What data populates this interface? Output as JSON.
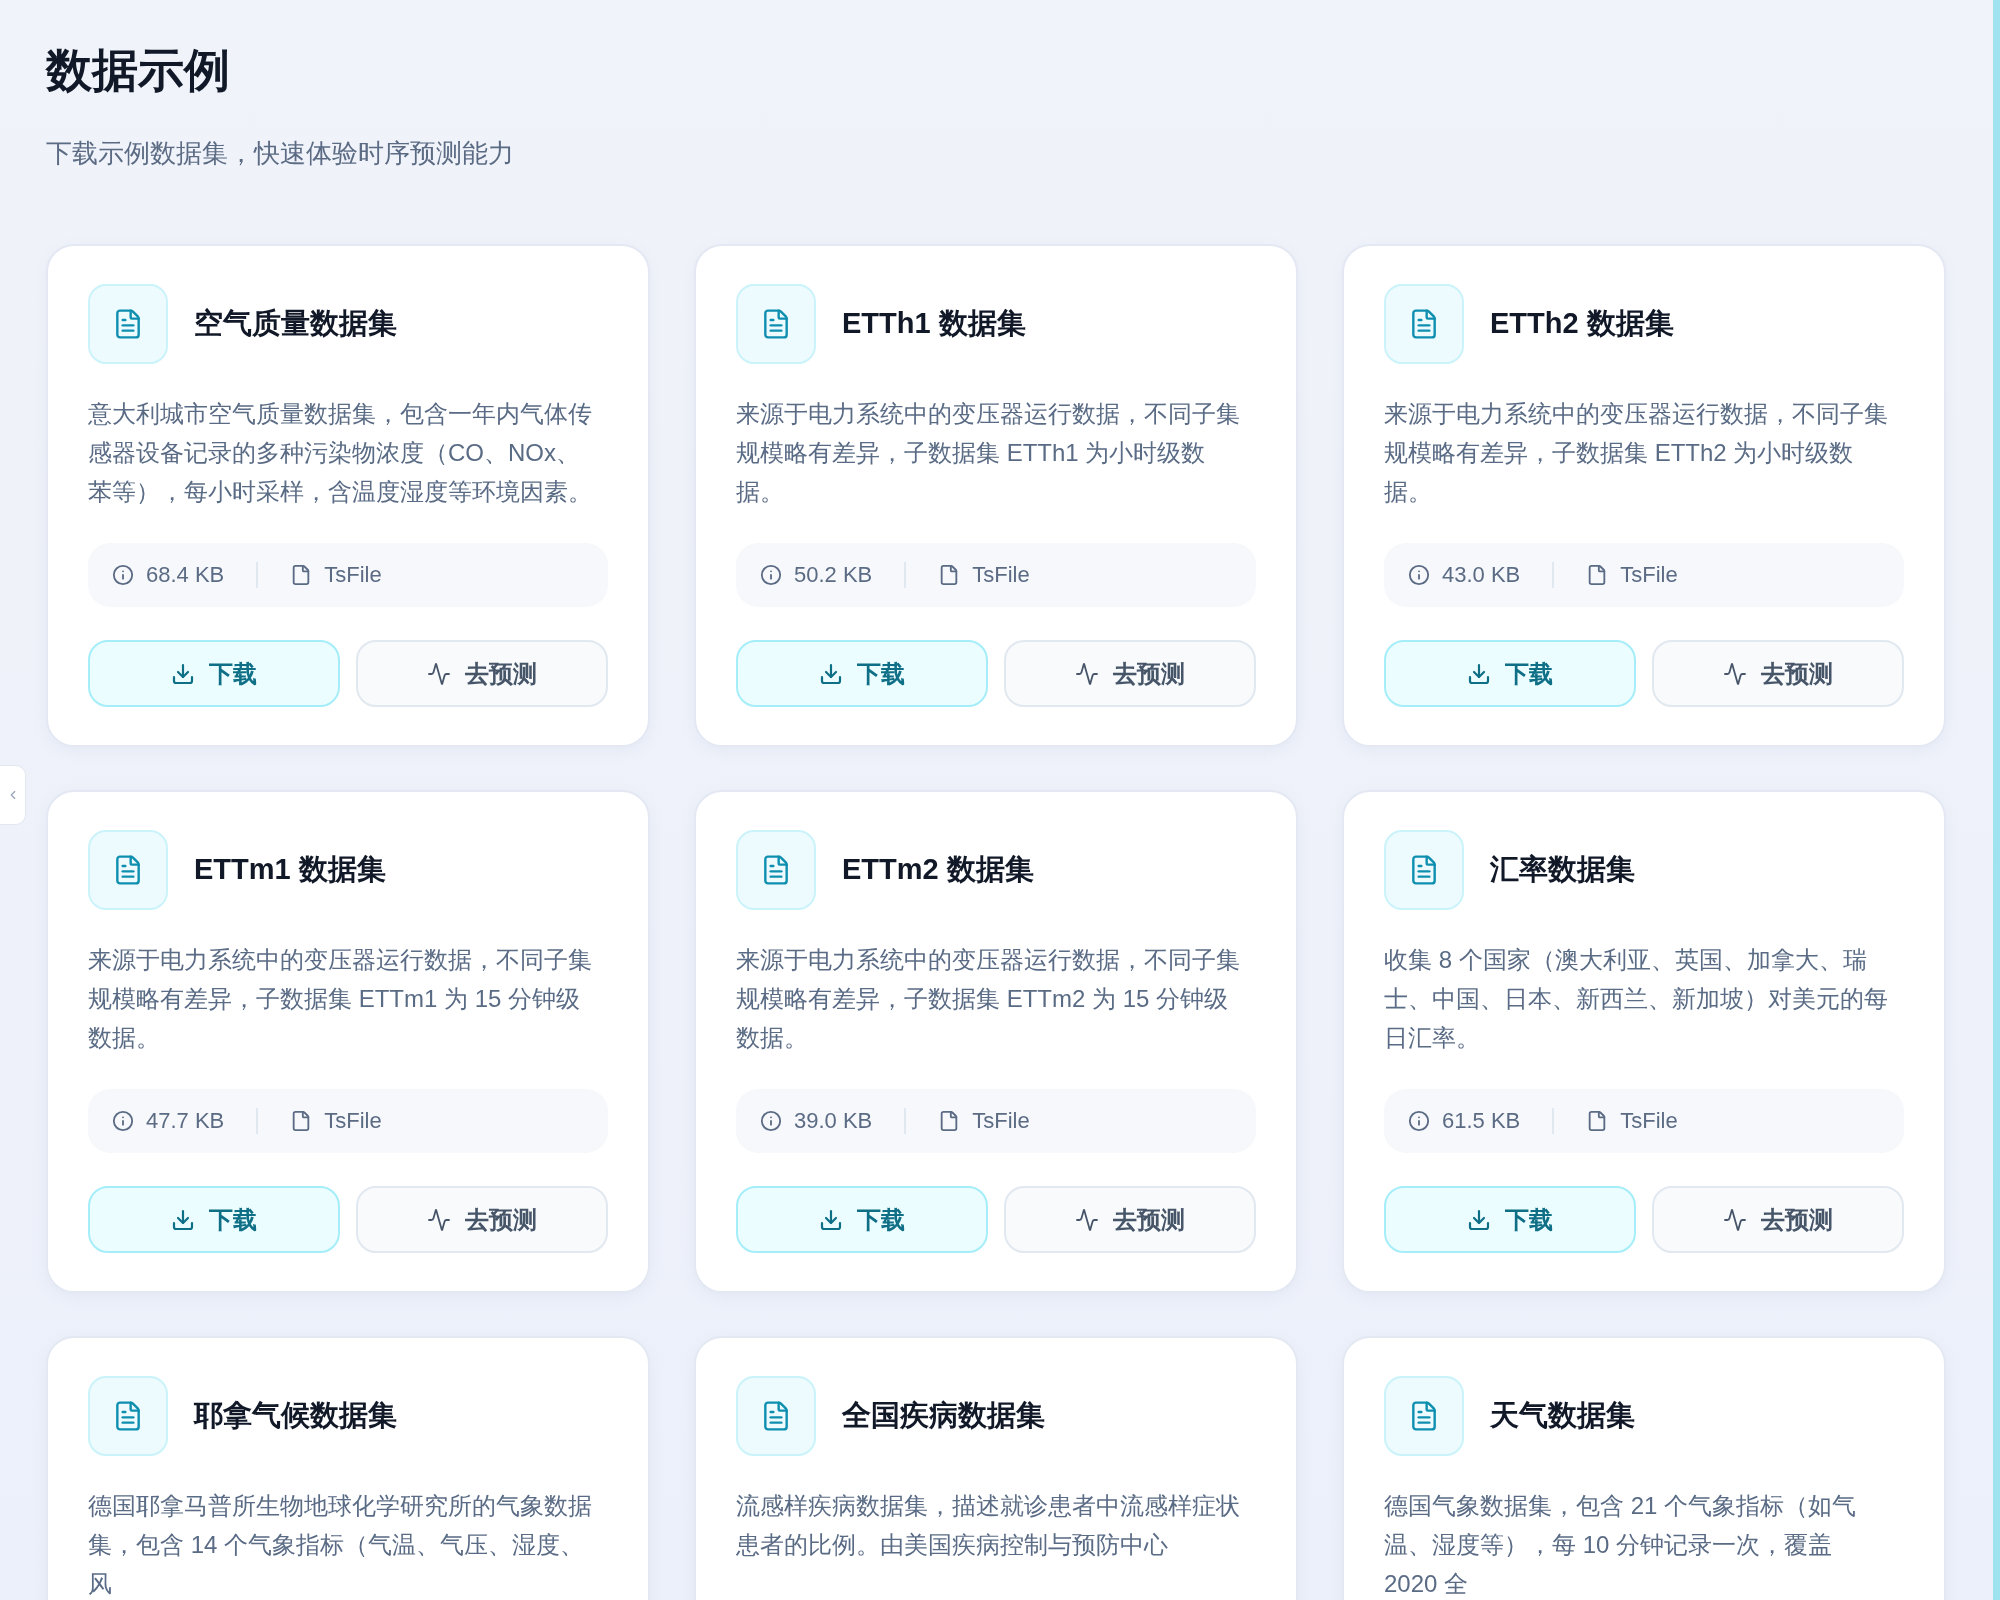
{
  "header": {
    "title": "数据示例",
    "subtitle": "下载示例数据集，快速体验时序预测能力"
  },
  "sidebar_toggle": {
    "collapsed": true
  },
  "datasets": [
    {
      "title": "空气质量数据集",
      "description": "意大利城市空气质量数据集，包含一年内气体传感器设备记录的多种污染物浓度（CO、NOx、苯等），每小时采样，含温度湿度等环境因素。",
      "size": "68.4 KB",
      "format": "TsFile",
      "download": "下载",
      "predict": "去预测"
    },
    {
      "title": "ETTh1 数据集",
      "description": "来源于电力系统中的变压器运行数据，不同子集规模略有差异，子数据集 ETTh1 为小时级数据。",
      "size": "50.2 KB",
      "format": "TsFile",
      "download": "下载",
      "predict": "去预测"
    },
    {
      "title": "ETTh2 数据集",
      "description": "来源于电力系统中的变压器运行数据，不同子集规模略有差异，子数据集 ETTh2 为小时级数据。",
      "size": "43.0 KB",
      "format": "TsFile",
      "download": "下载",
      "predict": "去预测"
    },
    {
      "title": "ETTm1 数据集",
      "description": "来源于电力系统中的变压器运行数据，不同子集规模略有差异，子数据集 ETTm1 为 15 分钟级数据。",
      "size": "47.7 KB",
      "format": "TsFile",
      "download": "下载",
      "predict": "去预测"
    },
    {
      "title": "ETTm2 数据集",
      "description": "来源于电力系统中的变压器运行数据，不同子集规模略有差异，子数据集 ETTm2 为 15 分钟级数据。",
      "size": "39.0 KB",
      "format": "TsFile",
      "download": "下载",
      "predict": "去预测"
    },
    {
      "title": "汇率数据集",
      "description": "收集 8 个国家（澳大利亚、英国、加拿大、瑞士、中国、日本、新西兰、新加坡）对美元的每日汇率。",
      "size": "61.5 KB",
      "format": "TsFile",
      "download": "下载",
      "predict": "去预测"
    },
    {
      "title": "耶拿气候数据集",
      "description": "德国耶拿马普所生物地球化学研究所的气象数据集，包含 14 个气象指标（气温、气压、湿度、风"
    },
    {
      "title": "全国疾病数据集",
      "description": "流感样疾病数据集，描述就诊患者中流感样症状患者的比例。由美国疾病控制与预防中心"
    },
    {
      "title": "天气数据集",
      "description": "德国气象数据集，包含 21 个气象指标（如气温、湿度等），每 10 分钟记录一次，覆盖 2020 全"
    }
  ]
}
